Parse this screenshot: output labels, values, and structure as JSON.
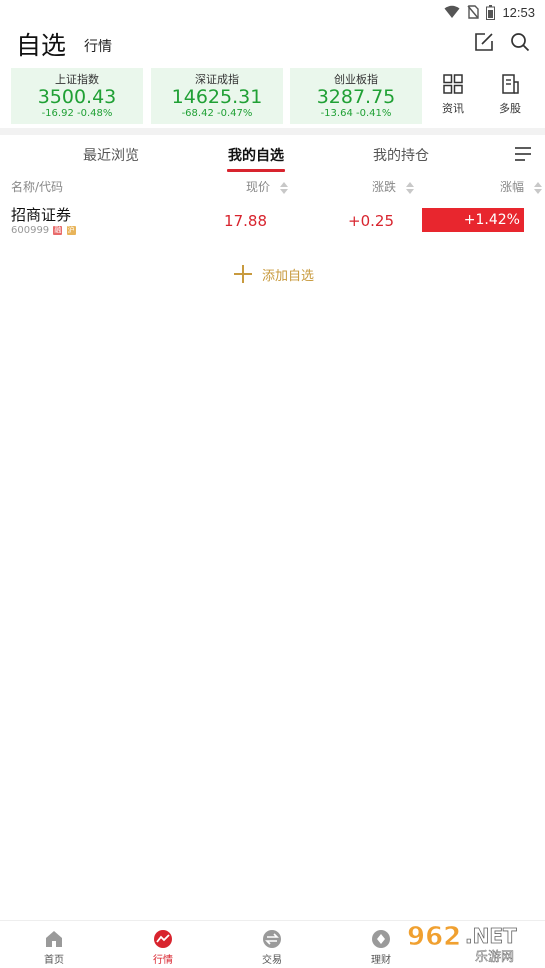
{
  "status_bar": {
    "time": "12:53",
    "icons": [
      "wifi-icon",
      "no-sim-icon",
      "battery-icon"
    ]
  },
  "header": {
    "title": "自选",
    "tab_label": "行情",
    "edit_icon": "edit-icon",
    "search_icon": "search-icon"
  },
  "indices": [
    {
      "name": "上证指数",
      "value": "3500.43",
      "change": "-16.92",
      "pct": "-0.48%"
    },
    {
      "name": "深证成指",
      "value": "14625.31",
      "change": "-68.42",
      "pct": "-0.47%"
    },
    {
      "name": "创业板指",
      "value": "3287.75",
      "change": "-13.64",
      "pct": "-0.41%"
    }
  ],
  "quick_links": [
    {
      "label": "资讯",
      "icon": "grid-icon"
    },
    {
      "label": "多股",
      "icon": "multi-stock-icon"
    }
  ],
  "tabs": [
    {
      "label": "最近浏览",
      "active": false
    },
    {
      "label": "我的自选",
      "active": true
    },
    {
      "label": "我的持仓",
      "active": false
    }
  ],
  "columns": {
    "name": "名称/代码",
    "price": "现价",
    "change": "涨跌",
    "pct": "涨幅"
  },
  "stocks": [
    {
      "name": "招商证券",
      "code": "600999",
      "badges": [
        "融",
        "沪"
      ],
      "price": "17.88",
      "change": "+0.25",
      "pct": "+1.42%"
    }
  ],
  "add_watchlist": {
    "label": "添加自选"
  },
  "bottom_nav": [
    {
      "label": "首页",
      "icon": "home-icon",
      "active": false
    },
    {
      "label": "行情",
      "icon": "market-icon",
      "active": true
    },
    {
      "label": "交易",
      "icon": "trade-icon",
      "active": false
    },
    {
      "label": "理财",
      "icon": "finance-icon",
      "active": false
    }
  ],
  "watermark": {
    "text": "962.NET 乐游网"
  },
  "colors": {
    "rise": "#d8242e",
    "fall": "#20a035",
    "index_bg": "#eaf7ec",
    "accent_gold": "#c89a3e"
  }
}
